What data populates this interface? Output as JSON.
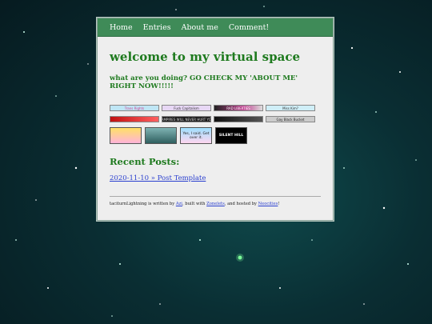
{
  "nav": {
    "home": "Home",
    "entries": "Entries",
    "about": "About me",
    "comment": "Comment!"
  },
  "header": {
    "title": "welcome to my virtual space",
    "subtitle": "what are you doing? GO CHECK MY 'ABOUT ME' RIGHT NOW!!!!!"
  },
  "badges_row1": [
    "Trans Rights",
    "Fuck Capitalism",
    "RAD LIBERTIES",
    "Miss Kim?"
  ],
  "badges_row2": [
    "",
    "VAMPIRES WILL NEVER HURT YOU",
    "",
    "Gay Black Bucket"
  ],
  "stamps": [
    "",
    "",
    "Yes, I said. Get over it.",
    "SILENT HILL"
  ],
  "recent": {
    "heading": "Recent Posts:",
    "post_link": "2020-11-10 » Post Template"
  },
  "footer": {
    "prefix": "taciturnLightning is written by ",
    "author": "Azi",
    "mid": ", built with ",
    "builder": "Zonelets",
    "mid2": ", and hosted by ",
    "host": "Neocities",
    "suffix": "!"
  },
  "colors": {
    "nav_bg": "#3f8b58",
    "heading": "#1e7a1e",
    "link": "#2a3fcf",
    "card_bg": "#eeeeee",
    "page_bg": "#0a2e33"
  }
}
